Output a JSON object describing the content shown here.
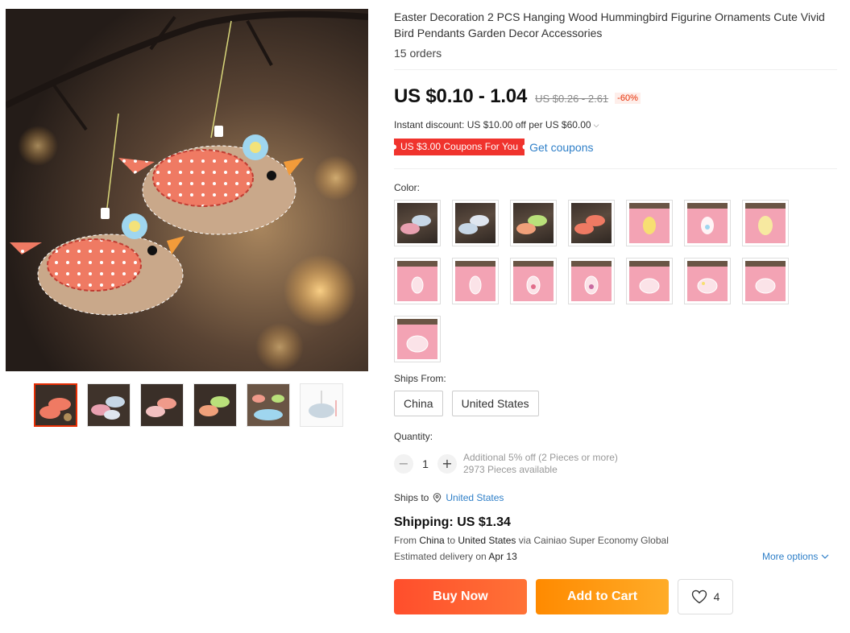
{
  "product": {
    "title": "Easter Decoration 2 PCS Hanging Wood Hummingbird Figurine Ornaments Cute Vivid Bird Pendants Garden Decor Accessories",
    "orders": "15 orders"
  },
  "price": {
    "current": "US $0.10 - 1.04",
    "original": "US $0.26 - 2.61",
    "discount": "-60%"
  },
  "promo": {
    "instant_discount": "Instant discount: US $10.00 off per US $60.00",
    "coupon": "US $3.00 Coupons For You",
    "get_coupons": "Get coupons"
  },
  "color": {
    "label": "Color:",
    "options_count": 15,
    "selected": null
  },
  "ships_from": {
    "label": "Ships From:",
    "options": [
      "China",
      "United States"
    ]
  },
  "quantity": {
    "label": "Quantity:",
    "minus": "−",
    "plus": "+",
    "value": "1",
    "additional": "Additional 5% off (2 Pieces or more)",
    "available": "2973 Pieces available"
  },
  "shipping": {
    "ships_to_label": "Ships to",
    "ships_to_value": "United States",
    "price": "Shipping: US $1.34",
    "route_from": "From ",
    "route_origin": "China",
    "route_to": " to ",
    "route_dest": "United States",
    "route_via": " via Cainiao Super Economy Global",
    "est_label": "Estimated delivery on ",
    "est_date": "Apr 13",
    "more_options": "More options"
  },
  "actions": {
    "buy_now": "Buy Now",
    "add_to_cart": "Add to Cart",
    "wishlist_count": "4"
  },
  "colors": {
    "accent_red": "#e62e04",
    "link_blue": "#2e7fc8",
    "buy_now": "#ff4e2c",
    "add_to_cart": "#ff8a00"
  }
}
